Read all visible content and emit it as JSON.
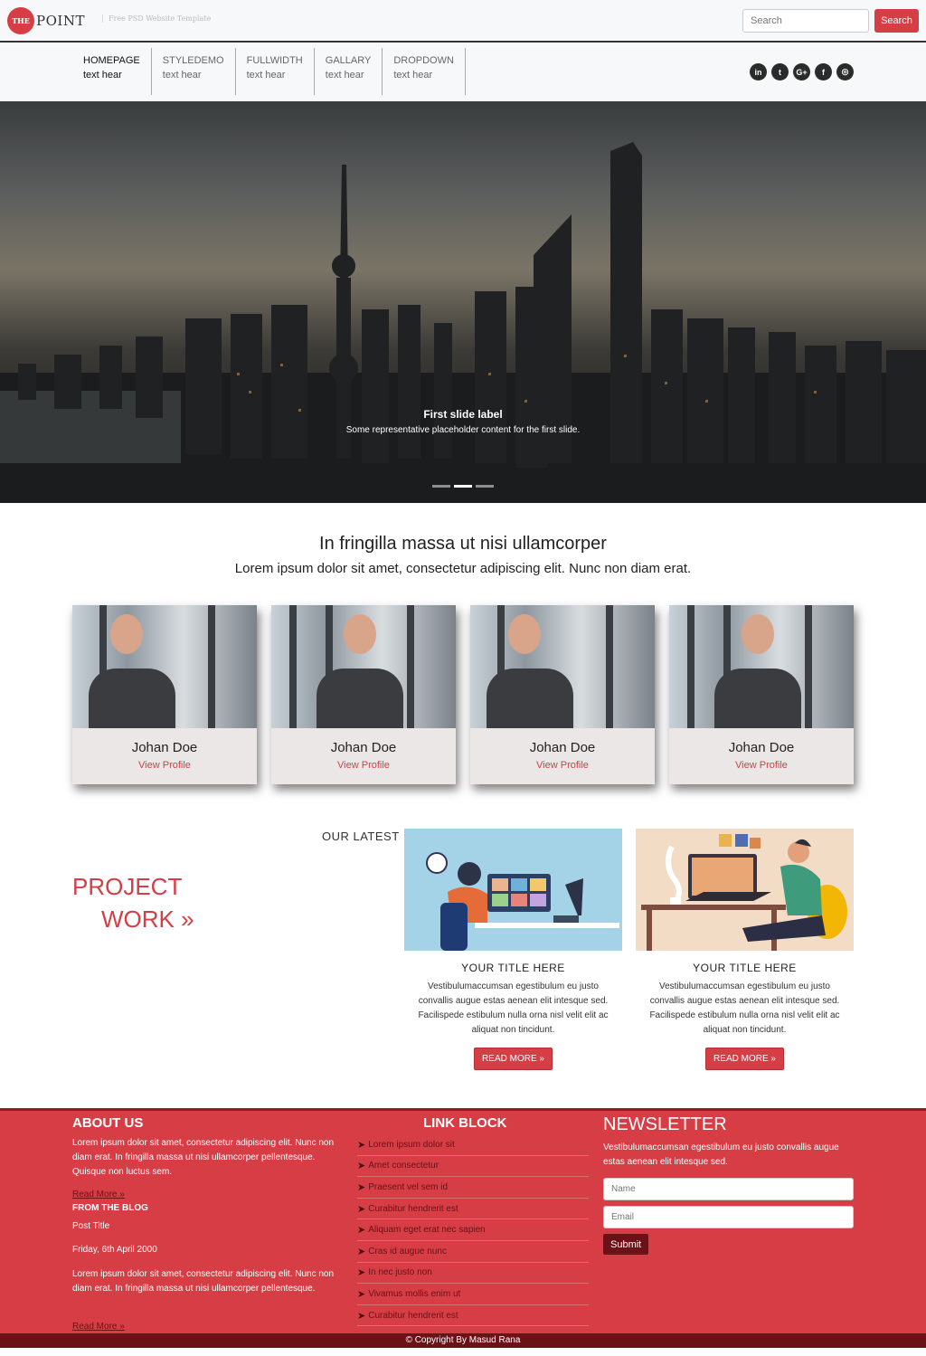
{
  "header": {
    "logo_badge": "THE",
    "logo_text": "POINT",
    "tagline": "Free PSD Website Template",
    "search_placeholder": "Search",
    "search_button": "Search"
  },
  "nav": {
    "items": [
      {
        "label": "HOMEPAGE",
        "sub": "text hear"
      },
      {
        "label": "STYLEDEMO",
        "sub": "text hear"
      },
      {
        "label": "FULLWIDTH",
        "sub": "text hear"
      },
      {
        "label": "GALLARY",
        "sub": "text hear"
      },
      {
        "label": "DROPDOWN",
        "sub": "text hear"
      }
    ],
    "socials": [
      {
        "icon": "linkedin-icon",
        "glyph": "in"
      },
      {
        "icon": "twitter-icon",
        "glyph": "t"
      },
      {
        "icon": "google-plus-icon",
        "glyph": "G+"
      },
      {
        "icon": "facebook-icon",
        "glyph": "f"
      },
      {
        "icon": "instagram-icon",
        "glyph": "◎"
      }
    ]
  },
  "hero": {
    "label": "First slide label",
    "text": "Some representative placeholder content for the first slide.",
    "active_slide": 2,
    "slide_count": 3
  },
  "intro": {
    "title": "In fringilla massa ut nisi ullamcorper",
    "subtitle": "Lorem ipsum dolor sit amet, consectetur adipiscing elit. Nunc non diam erat."
  },
  "team": [
    {
      "name": "Johan Doe",
      "link": "View Profile"
    },
    {
      "name": "Johan Doe",
      "link": "View Profile"
    },
    {
      "name": "Johan Doe",
      "link": "View Profile"
    },
    {
      "name": "Johan Doe",
      "link": "View Profile"
    }
  ],
  "projects": {
    "kicker": "OUR LATEST",
    "heading_line1": "PROJECT",
    "heading_line2": "WORK »",
    "items": [
      {
        "title": "YOUR TITLE HERE",
        "text": "Vestibulumaccumsan egestibulum eu justo convallis augue estas aenean elit intesque sed. Facilispede estibulum nulla orna nisl velit elit ac aliquat non tincidunt.",
        "button": "READ MORE »"
      },
      {
        "title": "YOUR TITLE HERE",
        "text": "Vestibulumaccumsan egestibulum eu justo convallis augue estas aenean elit intesque sed. Facilispede estibulum nulla orna nisl velit elit ac aliquat non tincidunt.",
        "button": "READ MORE »"
      }
    ]
  },
  "footer": {
    "about_heading": "ABOUT US",
    "about_text": "Lorem ipsum dolor sit amet, consectetur adipiscing elit. Nunc non diam erat. In fringilla massa ut nisi ullamcorper pellentesque. Quisque non luctus sem.",
    "about_link": "Read More »",
    "blog_heading": "FROM THE BLOG",
    "post_title": "Post Title",
    "post_date": "Friday, 6th April 2000",
    "post_text": "Lorem ipsum dolor sit amet, consectetur adipiscing elit. Nunc non diam erat. In fringilla massa ut nisi ullamcorper pellentesque.",
    "post_link": "Read More »",
    "links_heading": "LINK BLOCK",
    "links": [
      "Lorem ipsum dolor sit",
      "Amet consectetur",
      "Praesent vel sem id",
      "Curabitur hendrerit est",
      "Aliquam eget erat nec sapien",
      "Cras id augue nunc",
      "In nec justo non",
      "Vivamus mollis enim ut",
      "Curabitur hendrerit est"
    ],
    "newsletter_heading": "NEWSLETTER",
    "newsletter_text": "Vestibulumaccumsan egestibulum eu justo convallis augue estas aenean elit intesque sed.",
    "name_placeholder": "Name",
    "email_placeholder": "Email",
    "submit": "Submit",
    "copyright": "© Copyright By Masud Rana"
  },
  "colors": {
    "accent": "#d63d45",
    "dark_accent": "#6a1218"
  }
}
